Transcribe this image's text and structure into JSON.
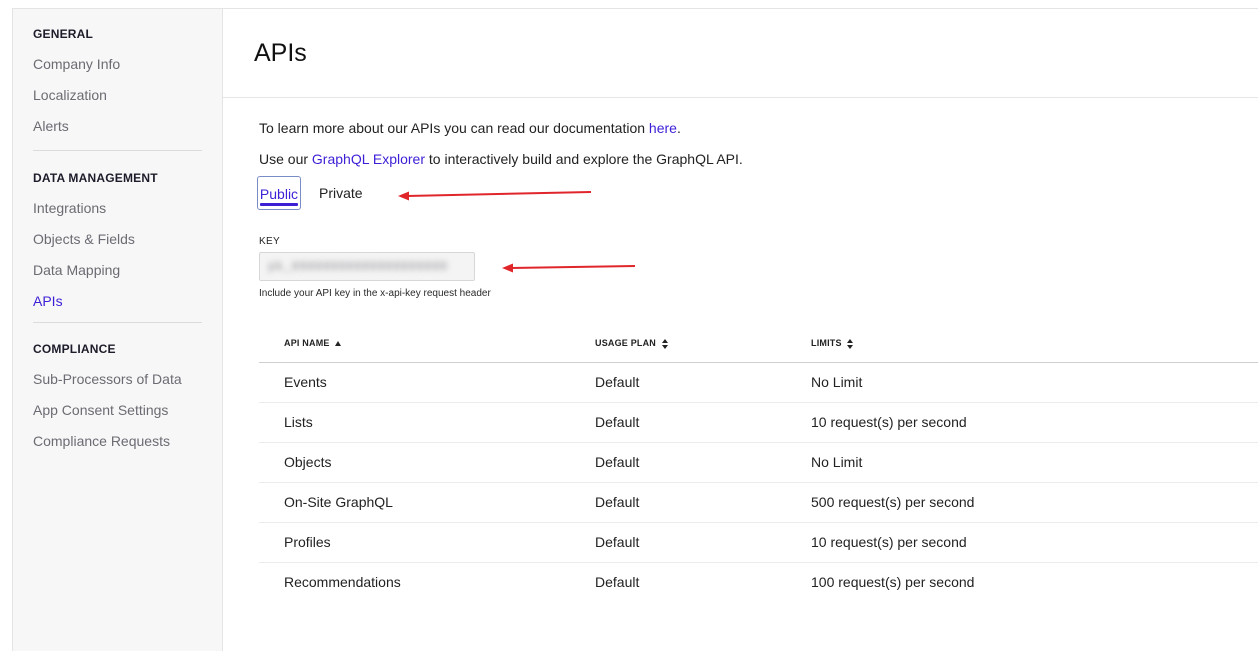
{
  "sidebar": {
    "sections": [
      {
        "heading": "GENERAL",
        "items": [
          "Company Info",
          "Localization",
          "Alerts"
        ]
      },
      {
        "heading": "DATA MANAGEMENT",
        "items": [
          "Integrations",
          "Objects & Fields",
          "Data Mapping",
          "APIs"
        ]
      },
      {
        "heading": "COMPLIANCE",
        "items": [
          "Sub-Processors of Data",
          "App Consent Settings",
          "Compliance Requests"
        ]
      }
    ],
    "active_item": "APIs"
  },
  "page": {
    "title": "APIs",
    "docs_line_prefix": "To learn more about our APIs you can read our documentation ",
    "docs_link": "here",
    "docs_line_suffix": ".",
    "explorer_prefix": "Use our ",
    "explorer_link": "GraphQL Explorer",
    "explorer_suffix": " to interactively build and explore the GraphQL API."
  },
  "tabs": {
    "public": "Public",
    "private": "Private",
    "active": "Public"
  },
  "key": {
    "label": "KEY",
    "value": "pk_00000000000000000000",
    "help": "Include your API key in the x-api-key request header"
  },
  "table": {
    "headers": [
      "API NAME",
      "USAGE PLAN",
      "LIMITS"
    ],
    "rows": [
      {
        "name": "Events",
        "plan": "Default",
        "limit": "No Limit"
      },
      {
        "name": "Lists",
        "plan": "Default",
        "limit": "10 request(s) per second"
      },
      {
        "name": "Objects",
        "plan": "Default",
        "limit": "No Limit"
      },
      {
        "name": "On-Site GraphQL",
        "plan": "Default",
        "limit": "500 request(s) per second"
      },
      {
        "name": "Profiles",
        "plan": "Default",
        "limit": "10 request(s) per second"
      },
      {
        "name": "Recommendations",
        "plan": "Default",
        "limit": "100 request(s) per second"
      }
    ]
  },
  "colors": {
    "accent": "#3d1fd6",
    "annotation_arrow": "#e0262b"
  }
}
